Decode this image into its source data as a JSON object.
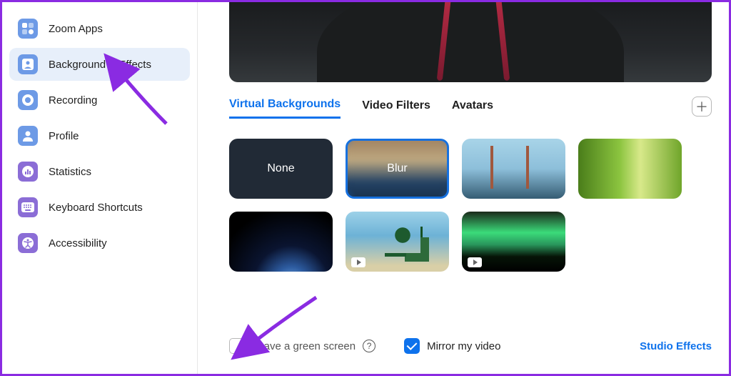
{
  "sidebar": {
    "items": [
      {
        "label": "Zoom Apps",
        "icon": "apps",
        "selected": false
      },
      {
        "label": "Background & Effects",
        "icon": "person-frame",
        "selected": true
      },
      {
        "label": "Recording",
        "icon": "record",
        "selected": false
      },
      {
        "label": "Profile",
        "icon": "profile",
        "selected": false
      },
      {
        "label": "Statistics",
        "icon": "stats",
        "selected": false
      },
      {
        "label": "Keyboard Shortcuts",
        "icon": "keyboard",
        "selected": false
      },
      {
        "label": "Accessibility",
        "icon": "accessibility",
        "selected": false
      }
    ]
  },
  "tabs": {
    "items": [
      {
        "label": "Virtual Backgrounds",
        "active": true
      },
      {
        "label": "Video Filters",
        "active": false
      },
      {
        "label": "Avatars",
        "active": false
      }
    ],
    "add_tooltip": "Add"
  },
  "backgrounds": {
    "none_label": "None",
    "blur_label": "Blur",
    "items_row1": [
      "none",
      "blur",
      "bridge",
      "grass"
    ],
    "items_row2": [
      "earth",
      "beach",
      "aurora"
    ],
    "selected": "blur"
  },
  "options": {
    "green_screen": {
      "label": "I have a green screen",
      "checked": false
    },
    "mirror": {
      "label": "Mirror my video",
      "checked": true
    },
    "studio_effects_label": "Studio Effects"
  },
  "colors": {
    "accent": "#0e72ec",
    "annotation": "#8a2be2"
  }
}
